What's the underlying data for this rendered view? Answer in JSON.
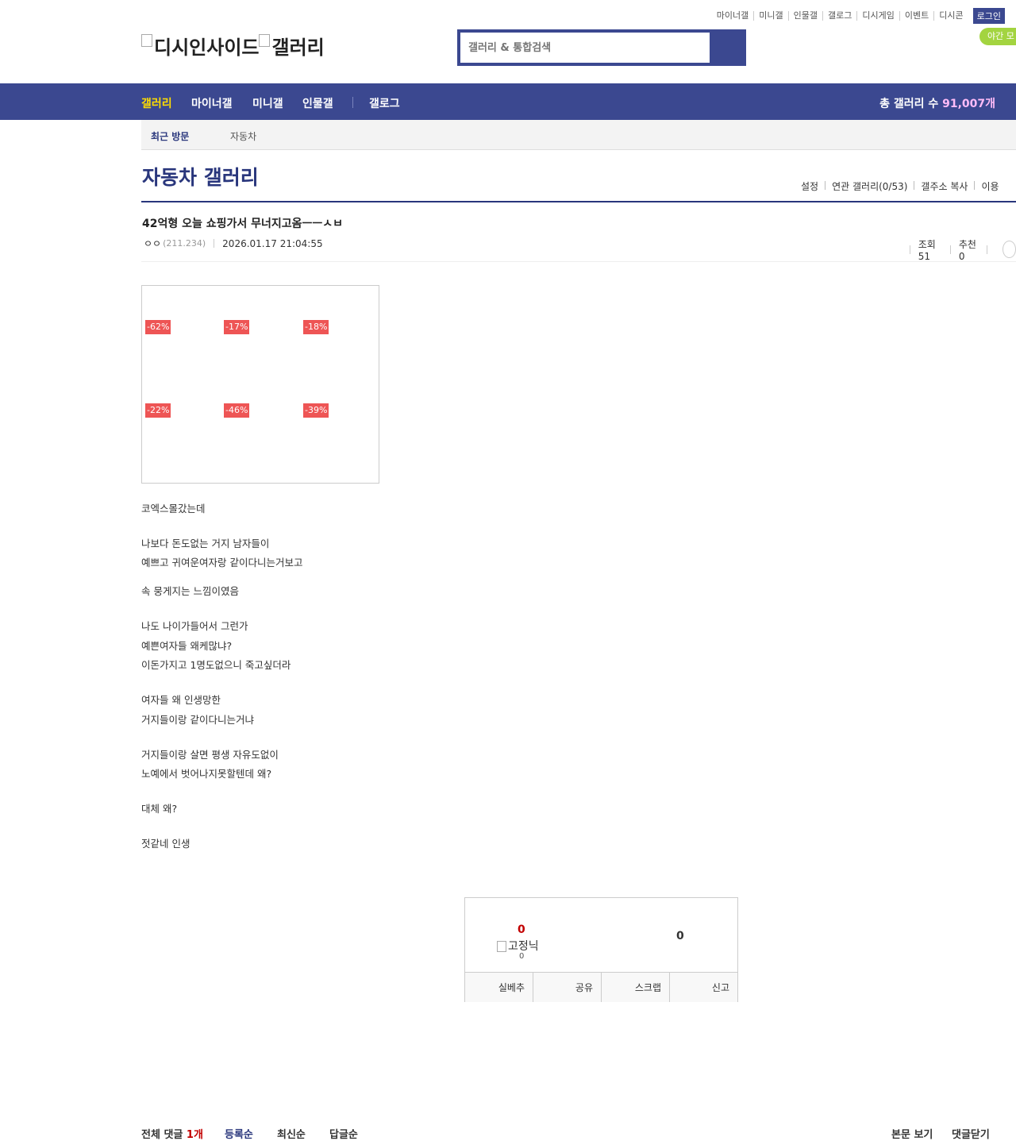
{
  "header": {
    "top_links": [
      "마이너갤",
      "미니갤",
      "인물갤",
      "갤로그",
      "디시게임",
      "이벤트",
      "디시콘"
    ],
    "login_label": "로그인",
    "night_mode_label": "야간 모",
    "logo_alt_1": "디시인사이드",
    "logo_alt_2": "갤러리",
    "search_placeholder": "갤러리 & 통합검색"
  },
  "nav": {
    "items": [
      "갤러리",
      "마이너갤",
      "미니갤",
      "인물갤",
      "갤로그"
    ],
    "total_label": "총 갤러리 수",
    "total_value": "91,007개"
  },
  "recent": {
    "label": "최근 방문",
    "item": "자동차"
  },
  "gallery": {
    "title": "자동차 갤러리",
    "links": [
      "설정",
      "연관 갤러리(0/53)",
      "갤주소 복사",
      "이용"
    ]
  },
  "post": {
    "title": "42억형 오늘 쇼핑가서 무너지고옴ㅡㅡㅅㅂ",
    "author": "ㅇㅇ",
    "ip": "(211.234)",
    "date": "2026.01.17 21:04:55",
    "views_label": "조회 51",
    "recommend_label": "추천 0",
    "discount_badges": [
      "-62%",
      "-17%",
      "-18%",
      "-22%",
      "-46%",
      "-39%"
    ],
    "body_lines": [
      "코엑스몰갔는데",
      "나보다 돈도없는 거지 남자들이",
      "예쁘고 귀여운여자랑 같이다니는거보고",
      "속 뭉게지는 느낌이였음",
      "나도 나이가들어서 그런가",
      "예쁜여자들 왜케많냐?",
      "이돈가지고 1명도없으니 죽고싶더라",
      "여자들 왜 인생망한",
      "거지들이랑 같이다니는거냐",
      "거지들이랑 살면 평생 자유도없이",
      "노예에서 벗어나지못할텐데 왜?",
      "대체 왜?",
      "젓같네 인생"
    ]
  },
  "vote": {
    "up_count": "0",
    "fix_nick_alt": "고정닉",
    "fix_count": "0",
    "down_count": "0",
    "buttons": [
      "실베추",
      "공유",
      "스크랩",
      "신고"
    ]
  },
  "comments": {
    "total_label": "전체 댓글",
    "total_count": "1개",
    "sort_options": [
      "등록순",
      "최신순",
      "답글순"
    ],
    "view_body": "본문 보기",
    "close_comments": "댓글닫기"
  }
}
